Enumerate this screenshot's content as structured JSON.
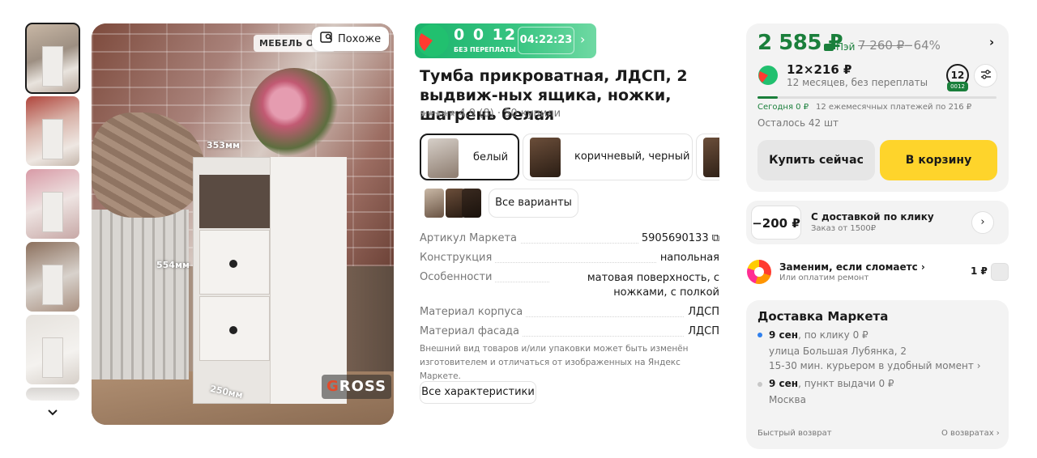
{
  "gallery": {
    "similar_label": "Похоже",
    "brand_tag": "МЕБЕЛЬ ОТ Г",
    "dims": {
      "width": "353мм",
      "height": "554мм",
      "depth": "250мм"
    },
    "watermark_g": "G",
    "watermark_rest": "ROSS"
  },
  "split": {
    "amount": "0 0 12",
    "subtitle": "БЕЗ ПЕРЕПЛАТЫ",
    "timer": "04:22:23",
    "accent": "#1ab36b"
  },
  "product": {
    "title": "Тумба прикроватная, ЛДСП, 2 выдвиж-ных ящика, ножки, шагрень белая",
    "stars": "★★★★★",
    "rating": "4.9",
    "reviews": "(8)",
    "bought": "· 50 купили"
  },
  "variants": [
    {
      "label": "белый",
      "selected": true
    },
    {
      "label": "коричневый, черный",
      "selected": false
    },
    {
      "label": "",
      "selected": false
    }
  ],
  "all_variants_label": "Все варианты",
  "specs": [
    {
      "key": "Артикул Маркета",
      "value": "5905690133 ⧉"
    },
    {
      "key": "Конструкция",
      "value": "напольная"
    },
    {
      "key": "Особенности",
      "value": "матовая поверхность, с ножками, с полкой"
    },
    {
      "key": "Материал корпуса",
      "value": "ЛДСП"
    },
    {
      "key": "Материал фасада",
      "value": "ЛДСП"
    }
  ],
  "disclaimer": "Внешний вид товаров и/или упаковки может быть изменён изготовителем и отличаться от изображенных на Яндекс Маркете.",
  "all_specs_label": "Все характеристики",
  "buy": {
    "price": "2 585 ₽",
    "pay_label": "Пэй",
    "old_price": "7 260 ₽",
    "discount": "−64%",
    "installment_main": "12×216 ₽",
    "installment_sub": "12 месяцев, без переплаты",
    "months": "12",
    "months_sub": "0012",
    "progress": 0.0833,
    "today": "Сегодня 0 ₽",
    "monthly": "12 ежемесячных платежей по 216 ₽",
    "stock": "Осталось 42 шт",
    "buy_now": "Купить сейчас",
    "to_cart": "В корзину",
    "green": "#1a7f3b",
    "yellow": "#fed42b"
  },
  "promo": {
    "amount": "−200 ₽",
    "title": "С доставкой по клику",
    "subtitle": "Заказ от 1500₽"
  },
  "replace": {
    "title": "Заменим, если сломаетс ›",
    "subtitle": "Или оплатим ремонт",
    "price": "1 ₽"
  },
  "delivery": {
    "title": "Доставка Маркета",
    "option1_date": "9 сен",
    "option1_rest": ", по клику  0 ₽",
    "option1_addr1": "улица Большая Лубянка, 2",
    "option1_addr2": "15-30 мин. курьером в удобный момент ›",
    "option2_date": "9 сен",
    "option2_rest": ", пункт выдачи  0 ₽",
    "option2_city": "Москва",
    "footer_left": "Быстрый возврат",
    "footer_right": "О возвратах ›"
  }
}
